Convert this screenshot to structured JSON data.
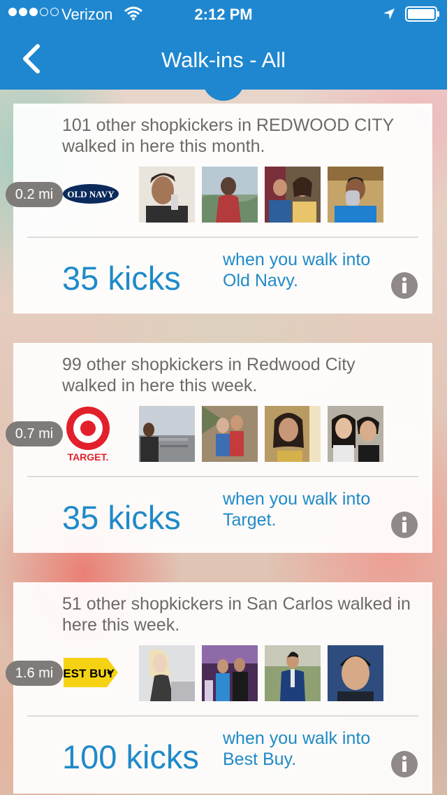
{
  "status_bar": {
    "carrier": "Verizon",
    "time": "2:12 PM",
    "signal_bars_full": 3,
    "signal_bars_total": 5
  },
  "nav": {
    "title": "Walk-ins - All",
    "back_icon": "chevron-left-icon"
  },
  "colors": {
    "brand_blue": "#1f87cf",
    "kicks_blue": "#1f8ac8",
    "text_gray": "#6d6966",
    "badge_gray": "#7f7b78"
  },
  "walkins": [
    {
      "store": "Old Navy",
      "logo_text": "OLD NAVY",
      "distance": "0.2 mi",
      "description": "101 other shopkickers in REDWOOD CITY walked in here this month.",
      "kicks": "35 kicks",
      "action": "when you walk into Old Navy."
    },
    {
      "store": "Target",
      "logo_text": "TARGET.",
      "distance": "0.7 mi",
      "description": "99 other shopkickers in Redwood City walked in here this week.",
      "kicks": "35 kicks",
      "action": "when you walk into Target."
    },
    {
      "store": "Best Buy",
      "logo_text": "BEST BUY",
      "distance": "1.6 mi",
      "description": "51 other shopkickers in San Carlos walked in here this week.",
      "kicks": "100 kicks",
      "action": "when you walk into Best Buy."
    }
  ]
}
